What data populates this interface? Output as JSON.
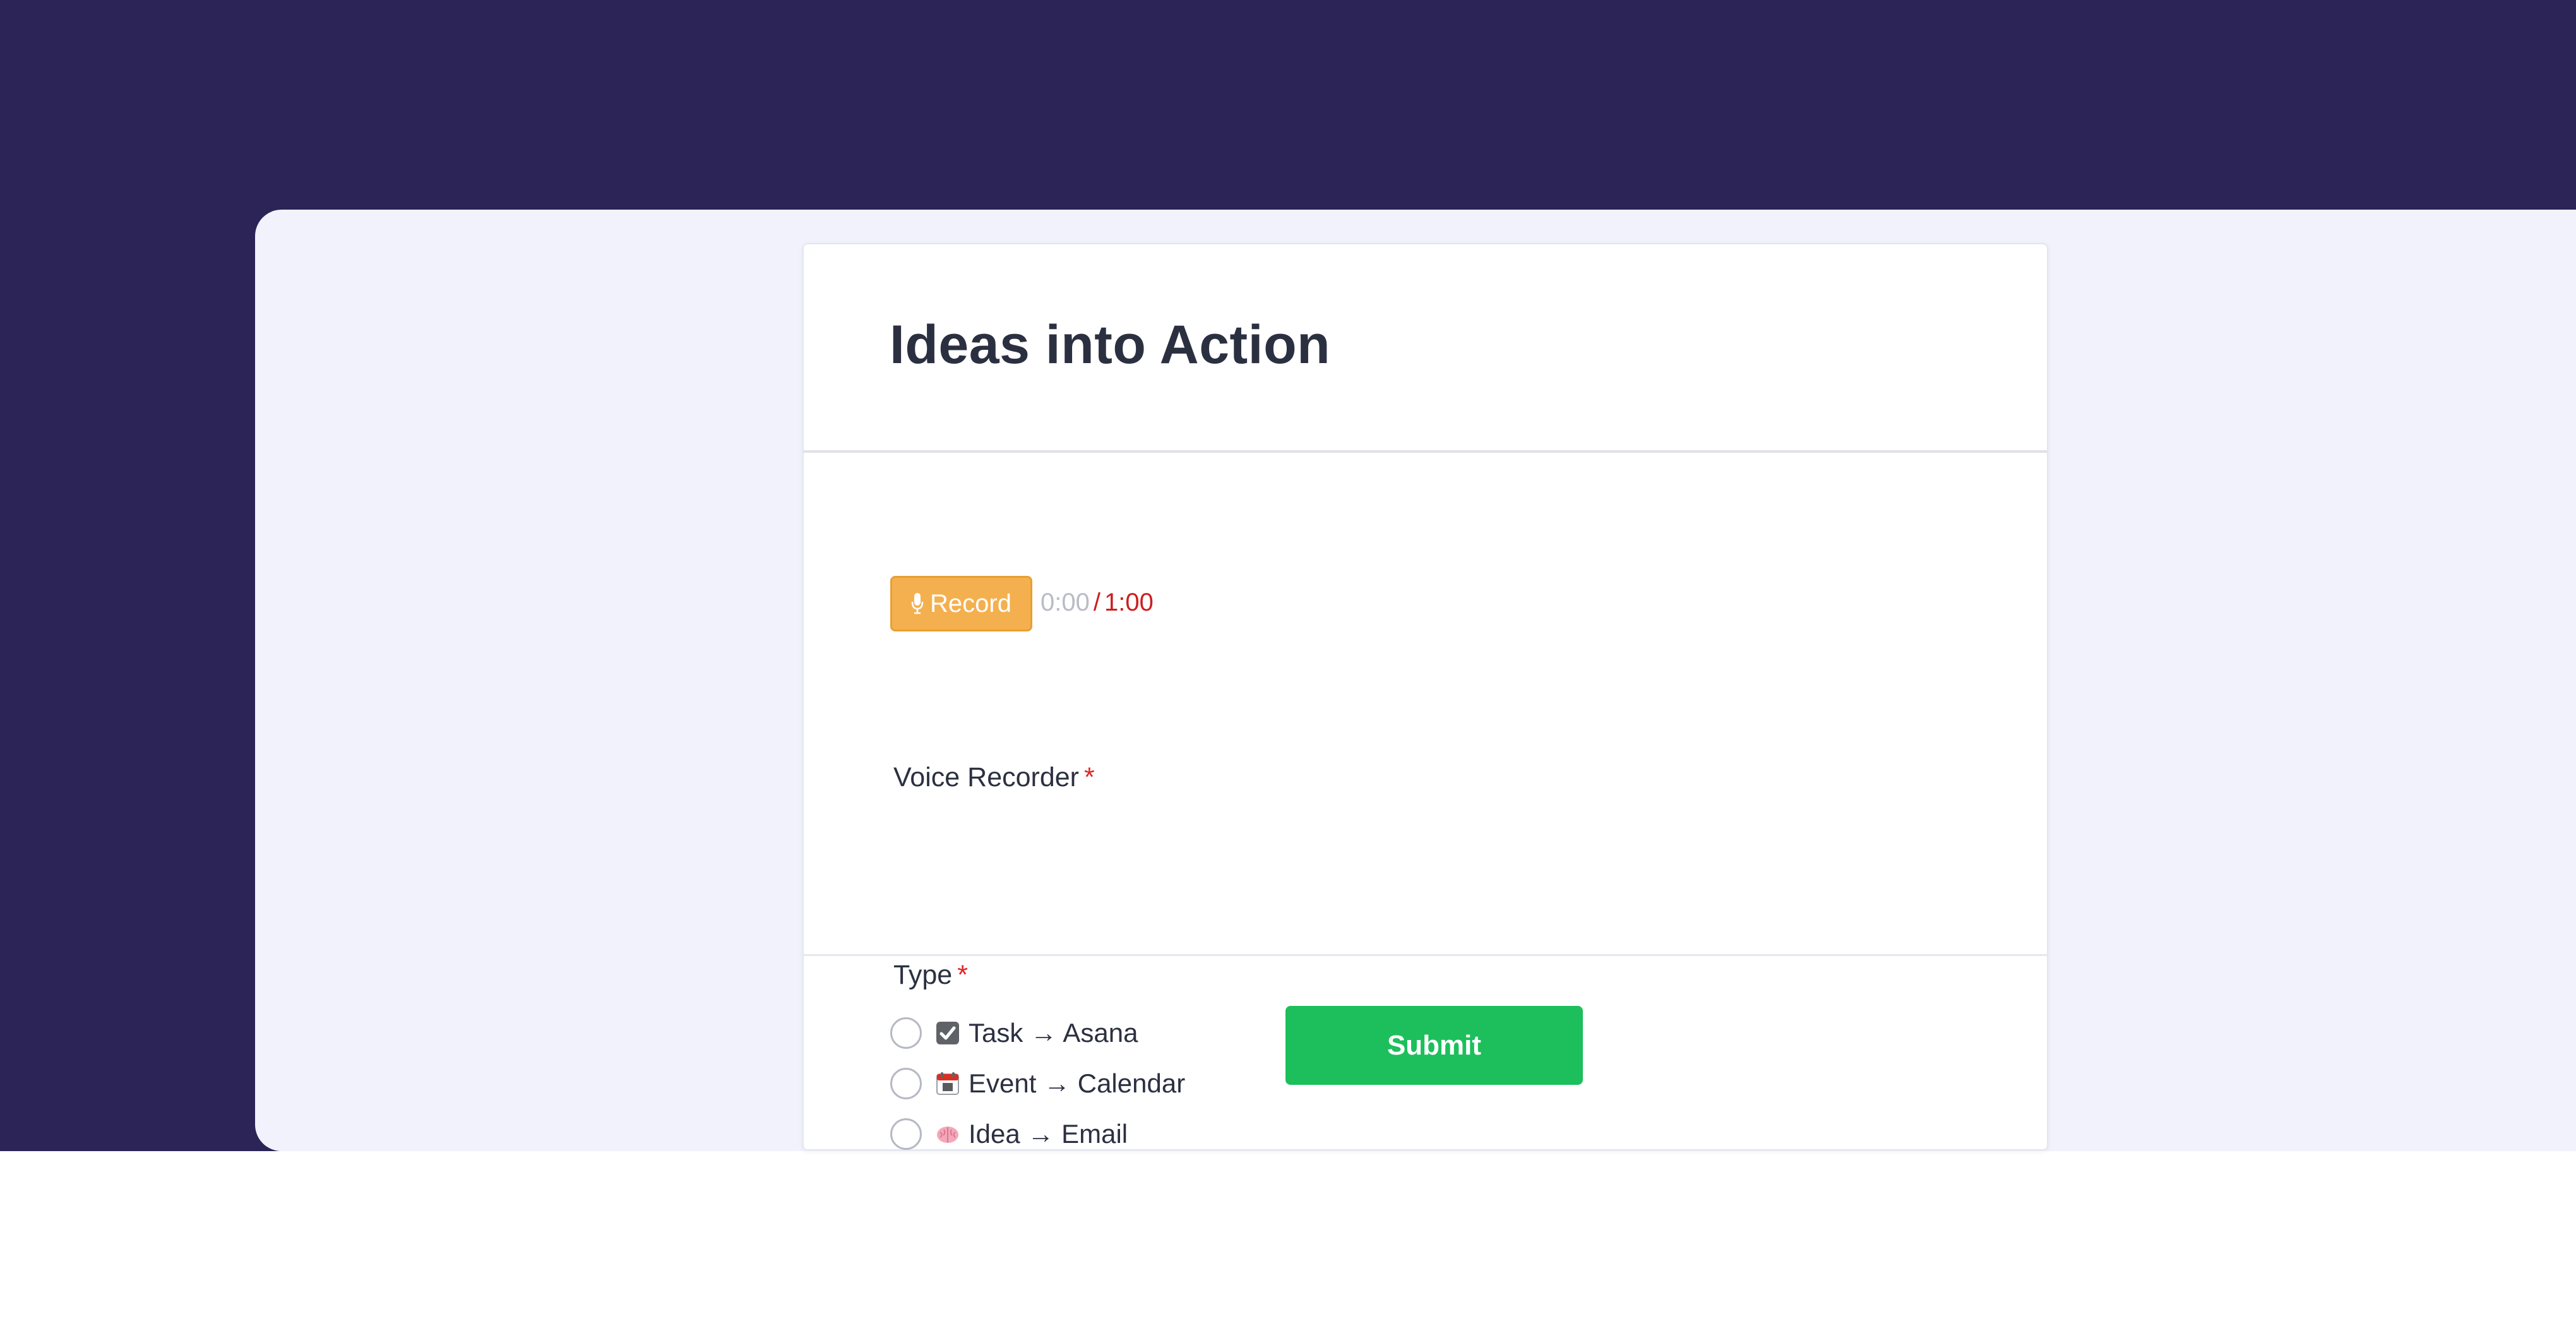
{
  "form": {
    "title": "Ideas into Action"
  },
  "voice_recorder": {
    "label": "Voice Recorder",
    "required_mark": "*",
    "record_label": "Record",
    "elapsed": "0:00",
    "separator": "/",
    "limit": "1:00",
    "icon": "microphone-icon"
  },
  "type_field": {
    "label": "Type",
    "required_mark": "*",
    "options": [
      {
        "label": "Task → Asana",
        "icon": "check-box-icon",
        "selected": false
      },
      {
        "label": "Event → Calendar",
        "icon": "calendar-icon",
        "selected": false
      },
      {
        "label": "Idea → Email",
        "icon": "brain-icon",
        "selected": false
      }
    ]
  },
  "submit": {
    "label": "Submit"
  },
  "colors": {
    "backdrop": "#2c2356",
    "panel": "#f1f2fb",
    "record_button": "#f4b04f",
    "submit_button": "#1cbf5b",
    "required": "#e02424",
    "timer_limit": "#cc1f1f"
  }
}
